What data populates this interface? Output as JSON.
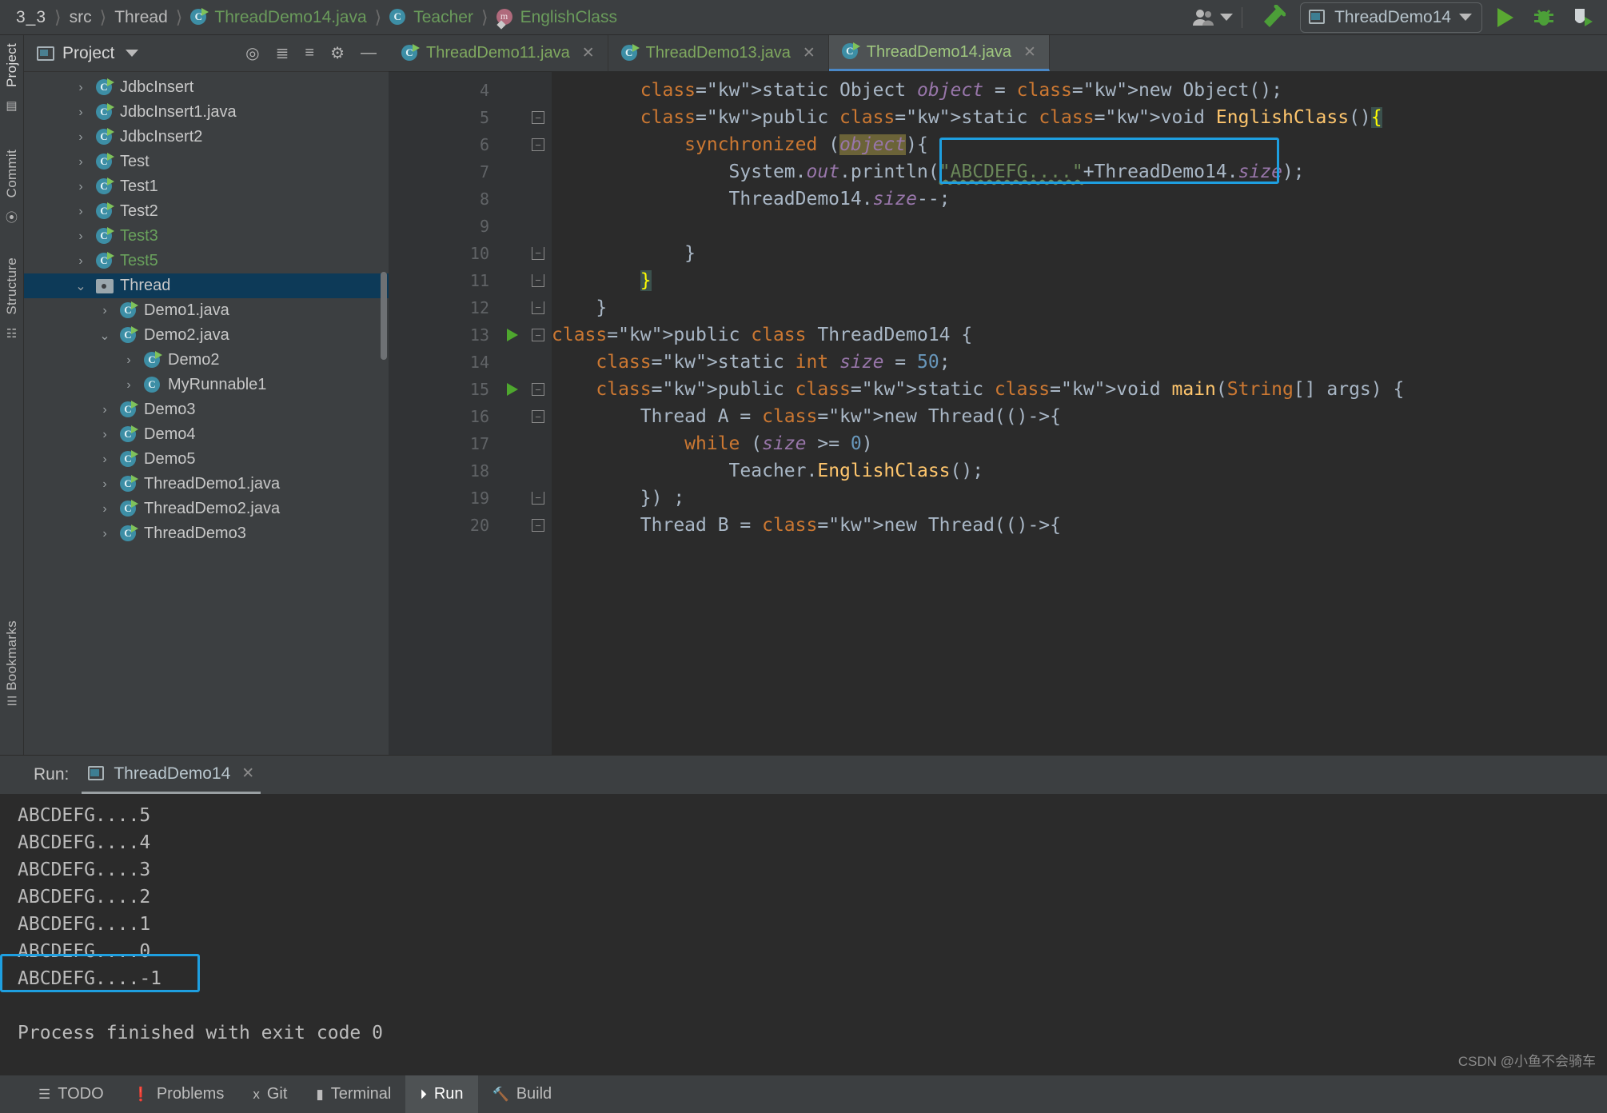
{
  "breadcrumb": {
    "items": [
      {
        "label": "3_3",
        "icon": "project-icon",
        "style": "proj"
      },
      {
        "label": "src",
        "icon": "none",
        "style": "plain"
      },
      {
        "label": "Thread",
        "icon": "none",
        "style": "plain"
      },
      {
        "label": "ThreadDemo14.java",
        "icon": "class-icon",
        "style": "green"
      },
      {
        "label": "Teacher",
        "icon": "class-icon",
        "style": "green"
      },
      {
        "label": "EnglishClass",
        "icon": "method-icon",
        "style": "green"
      }
    ]
  },
  "toolbar": {
    "account_icon": "people-icon",
    "build_icon": "hammer-icon",
    "run_config_name": "ThreadDemo14",
    "run_icon": "run-triangle-icon",
    "debug_icon": "bug-icon",
    "coverage_icon": "run-coverage-icon",
    "dropdown_icon": "chevron-down-icon"
  },
  "left_strip": {
    "items": [
      "Project",
      "Commit",
      "Structure"
    ],
    "bookmarks_label": "Bookmarks"
  },
  "project_panel": {
    "title": "Project",
    "dropdown_icon": "chevron-down-icon",
    "actions": [
      "locate-icon",
      "expand-all-icon",
      "collapse-all-icon",
      "gear-icon",
      "minimize-icon"
    ],
    "tree": [
      {
        "label": "JdbcInsert",
        "icon": "class-icon",
        "arrow": "right",
        "indent": 1,
        "color": "gray",
        "selected": false
      },
      {
        "label": "JdbcInsert1.java",
        "icon": "class-icon",
        "arrow": "right",
        "indent": 1,
        "color": "gray",
        "selected": false
      },
      {
        "label": "JdbcInsert2",
        "icon": "class-icon",
        "arrow": "right",
        "indent": 1,
        "color": "gray",
        "selected": false
      },
      {
        "label": "Test",
        "icon": "class-icon",
        "arrow": "right",
        "indent": 1,
        "color": "gray",
        "selected": false
      },
      {
        "label": "Test1",
        "icon": "class-icon",
        "arrow": "right",
        "indent": 1,
        "color": "gray",
        "selected": false
      },
      {
        "label": "Test2",
        "icon": "class-icon",
        "arrow": "right",
        "indent": 1,
        "color": "gray",
        "selected": false
      },
      {
        "label": "Test3",
        "icon": "class-icon",
        "arrow": "right",
        "indent": 1,
        "color": "green",
        "selected": false
      },
      {
        "label": "Test5",
        "icon": "class-icon",
        "arrow": "right",
        "indent": 1,
        "color": "green",
        "selected": false
      },
      {
        "label": "Thread",
        "icon": "folder-icon",
        "arrow": "down",
        "indent": 1,
        "color": "gray",
        "selected": true
      },
      {
        "label": "Demo1.java",
        "icon": "class-icon",
        "arrow": "right",
        "indent": 2,
        "color": "gray",
        "selected": false
      },
      {
        "label": "Demo2.java",
        "icon": "class-icon",
        "arrow": "down",
        "indent": 2,
        "color": "gray",
        "selected": false
      },
      {
        "label": "Demo2",
        "icon": "class-icon",
        "arrow": "right",
        "indent": 3,
        "color": "gray",
        "selected": false
      },
      {
        "label": "MyRunnable1",
        "icon": "class-plain-icon",
        "arrow": "right",
        "indent": 3,
        "color": "gray",
        "selected": false
      },
      {
        "label": "Demo3",
        "icon": "class-icon",
        "arrow": "right",
        "indent": 2,
        "color": "gray",
        "selected": false
      },
      {
        "label": "Demo4",
        "icon": "class-icon",
        "arrow": "right",
        "indent": 2,
        "color": "gray",
        "selected": false
      },
      {
        "label": "Demo5",
        "icon": "class-icon",
        "arrow": "right",
        "indent": 2,
        "color": "gray",
        "selected": false
      },
      {
        "label": "ThreadDemo1.java",
        "icon": "class-icon",
        "arrow": "right",
        "indent": 2,
        "color": "gray",
        "selected": false
      },
      {
        "label": "ThreadDemo2.java",
        "icon": "class-icon",
        "arrow": "right",
        "indent": 2,
        "color": "gray",
        "selected": false
      },
      {
        "label": "ThreadDemo3",
        "icon": "class-icon",
        "arrow": "right",
        "indent": 2,
        "color": "gray",
        "selected": false
      }
    ]
  },
  "editor": {
    "tabs": [
      {
        "label": "ThreadDemo11.java",
        "active": false,
        "close_icon": "close-icon"
      },
      {
        "label": "ThreadDemo13.java",
        "active": false,
        "close_icon": "close-icon"
      },
      {
        "label": "ThreadDemo14.java",
        "active": true,
        "close_icon": "close-icon"
      }
    ],
    "lines": [
      {
        "num": "4",
        "gutter_run": false,
        "fold": "none",
        "text": "        static Object object = new Object();"
      },
      {
        "num": "5",
        "gutter_run": false,
        "fold": "minus",
        "text": "        public static void EnglishClass(){"
      },
      {
        "num": "6",
        "gutter_run": false,
        "fold": "minus",
        "text": "            synchronized (object){"
      },
      {
        "num": "7",
        "gutter_run": false,
        "fold": "none",
        "text": "                System.out.println(\"ABCDEFG....\"+ThreadDemo14.size);"
      },
      {
        "num": "8",
        "gutter_run": false,
        "fold": "none",
        "text": "                ThreadDemo14.size--;"
      },
      {
        "num": "9",
        "gutter_run": false,
        "fold": "none",
        "text": ""
      },
      {
        "num": "10",
        "gutter_run": false,
        "fold": "end",
        "text": "            }"
      },
      {
        "num": "11",
        "gutter_run": false,
        "fold": "end",
        "text": "        }"
      },
      {
        "num": "12",
        "gutter_run": false,
        "fold": "end",
        "text": "    }"
      },
      {
        "num": "13",
        "gutter_run": true,
        "fold": "minus",
        "text": "public class ThreadDemo14 {"
      },
      {
        "num": "14",
        "gutter_run": false,
        "fold": "none",
        "text": "    static int size = 50;"
      },
      {
        "num": "15",
        "gutter_run": true,
        "fold": "minus",
        "text": "    public static void main(String[] args) {"
      },
      {
        "num": "16",
        "gutter_run": false,
        "fold": "minus",
        "text": "        Thread A = new Thread(()->{"
      },
      {
        "num": "17",
        "gutter_run": false,
        "fold": "none",
        "text": "            while (size >= 0)"
      },
      {
        "num": "18",
        "gutter_run": false,
        "fold": "none",
        "text": "                Teacher.EnglishClass();"
      },
      {
        "num": "19",
        "gutter_run": false,
        "fold": "end",
        "text": "        }) ;"
      },
      {
        "num": "20",
        "gutter_run": false,
        "fold": "minus",
        "text": "        Thread B = new Thread(()->{"
      }
    ],
    "highlight_box_label": "annotation-box-println"
  },
  "run_panel": {
    "label": "Run:",
    "tab_label": "ThreadDemo14",
    "tab_icon": "run-config-icon",
    "close_icon": "close-icon",
    "console_lines": [
      "ABCDEFG....5",
      "ABCDEFG....4",
      "ABCDEFG....3",
      "ABCDEFG....2",
      "ABCDEFG....1",
      "ABCDEFG....0",
      "ABCDEFG....-1",
      "",
      "Process finished with exit code 0"
    ],
    "highlighted_line_index": 6
  },
  "status_bar": {
    "items": [
      {
        "label": "TODO",
        "icon": "list-icon",
        "active": false
      },
      {
        "label": "Problems",
        "icon": "warning-icon",
        "active": false
      },
      {
        "label": "Git",
        "icon": "git-branch-icon",
        "active": false
      },
      {
        "label": "Terminal",
        "icon": "terminal-icon",
        "active": false
      },
      {
        "label": "Run",
        "icon": "run-triangle-icon",
        "active": true
      },
      {
        "label": "Build",
        "icon": "hammer-icon",
        "active": false
      }
    ]
  },
  "watermark": "CSDN @小鱼不会骑车",
  "colors": {
    "accent_blue": "#1e9fe0",
    "selection_blue": "#0d3a58",
    "run_green": "#5aa832",
    "keyword_orange": "#cc7832",
    "string_green": "#6a8759",
    "field_purple": "#9876aa",
    "number_blue": "#6897bb",
    "method_yellow": "#ffc66d",
    "editor_bg": "#2b2b2b",
    "panel_bg": "#3c3f41"
  }
}
